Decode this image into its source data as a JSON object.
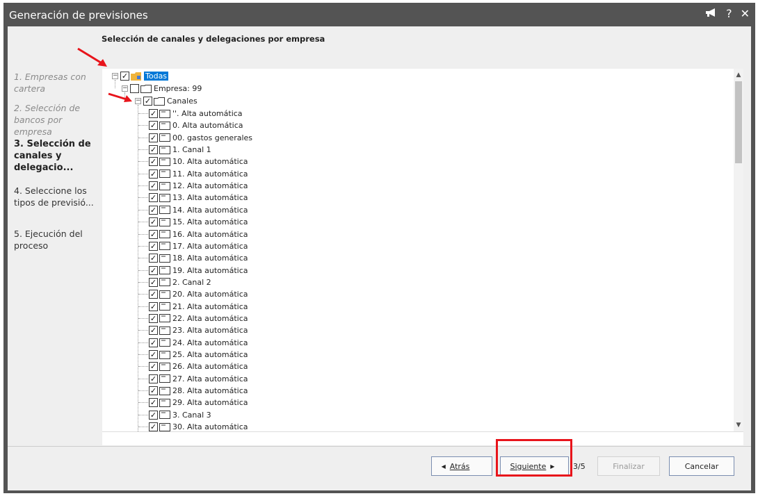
{
  "window": {
    "title": "Generación de previsiones"
  },
  "header": {
    "title": "Selección de canales y delegaciones por empresa"
  },
  "steps": [
    {
      "label": "1. Empresas con cartera",
      "state": "done"
    },
    {
      "label": "2. Selección de bancos por empresa",
      "state": "done"
    },
    {
      "label": "3. Selección de canales y delegacio...",
      "state": "current"
    },
    {
      "label": "4. Seleccione los tipos de previsió...",
      "state": "todo"
    },
    {
      "label": "5. Ejecución del proceso",
      "state": "todo"
    }
  ],
  "tree": {
    "root": "Todas",
    "empresa": "Empresa: 99",
    "canales": "Canales",
    "items": [
      "''. Alta automática",
      "0. Alta automática",
      "00. gastos generales",
      "1. Canal 1",
      "10. Alta automática",
      "11. Alta automática",
      "12. Alta automática",
      "13. Alta automática",
      "14. Alta automática",
      "15. Alta automática",
      "16. Alta automática",
      "17. Alta automática",
      "18. Alta automática",
      "19. Alta automática",
      "2. Canal 2",
      "20. Alta automática",
      "21. Alta automática",
      "22. Alta automática",
      "23. Alta automática",
      "24. Alta automática",
      "25. Alta automática",
      "26. Alta automática",
      "27. Alta automática",
      "28. Alta automática",
      "29. Alta automática",
      "3. Canal 3",
      "30. Alta automática"
    ]
  },
  "buttons": {
    "back": "Atrás",
    "next": "Siguiente",
    "page": "3/5",
    "finish": "Finalizar",
    "cancel": "Cancelar"
  },
  "colors": {
    "highlight": "#e8141b",
    "selection": "#0078d7",
    "titlebar": "#545454"
  }
}
